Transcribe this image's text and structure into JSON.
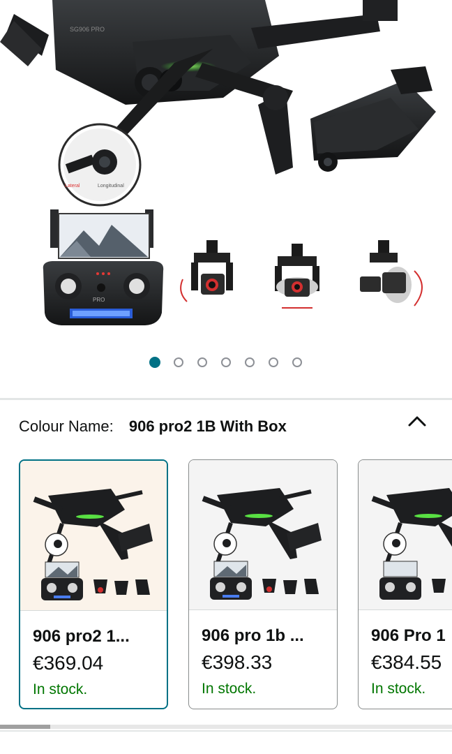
{
  "carousel": {
    "dot_count": 7,
    "active_index": 0,
    "colors": {
      "active": "#007185",
      "inactive": "#8d9096"
    }
  },
  "variant": {
    "label": "Colour Name:",
    "value": "906 pro2 1B With Box"
  },
  "options": [
    {
      "name": "906 pro2 1...",
      "price": "€369.04",
      "stock": "In stock.",
      "selected": true
    },
    {
      "name": "906 pro 1b ...",
      "price": "€398.33",
      "stock": "In stock.",
      "selected": false
    },
    {
      "name": "906 Pro 1",
      "price": "€384.55",
      "stock": "In stock.",
      "selected": false
    }
  ],
  "colors": {
    "accent": "#007185",
    "in_stock": "#007600"
  }
}
